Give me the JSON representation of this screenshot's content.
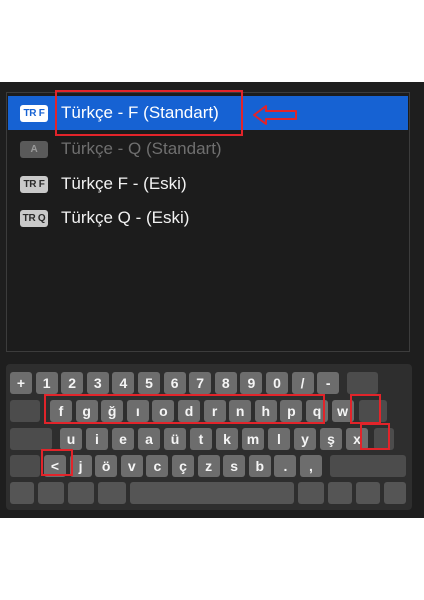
{
  "layouts": [
    {
      "badge": "TR F",
      "label": "Türkçe - F (Standart)",
      "state": "selected"
    },
    {
      "badge": "A",
      "label": "Türkçe - Q (Standart)",
      "state": "disabled"
    },
    {
      "badge": "TR F",
      "label": "Türkçe F - (Eski)",
      "state": "normal"
    },
    {
      "badge": "TR Q",
      "label": "Türkçe Q - (Eski)",
      "state": "normal"
    }
  ],
  "keyboard": {
    "row1": [
      "+",
      "1",
      "2",
      "3",
      "4",
      "5",
      "6",
      "7",
      "8",
      "9",
      "0",
      "/",
      "-"
    ],
    "row2": [
      "f",
      "g",
      "ğ",
      "ı",
      "o",
      "d",
      "r",
      "n",
      "h",
      "p",
      "q",
      "w"
    ],
    "row3": [
      "u",
      "i",
      "e",
      "a",
      "ü",
      "t",
      "k",
      "m",
      "l",
      "y",
      "ş",
      "x"
    ],
    "row4": [
      "<",
      "j",
      "ö",
      "v",
      "c",
      "ç",
      "z",
      "s",
      "b",
      ".",
      ","
    ]
  },
  "colors": {
    "selection": "#1662d3",
    "highlight": "#e2242a"
  }
}
